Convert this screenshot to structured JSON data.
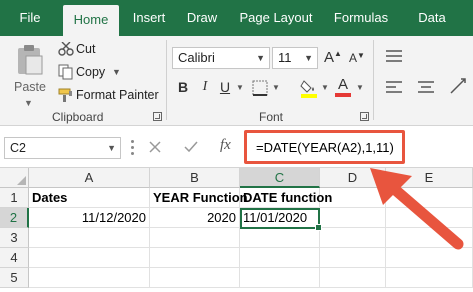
{
  "tabs": [
    {
      "label": "File",
      "active": false
    },
    {
      "label": "Home",
      "active": true
    },
    {
      "label": "Insert",
      "active": false
    },
    {
      "label": "Draw",
      "active": false
    },
    {
      "label": "Page Layout",
      "active": false
    },
    {
      "label": "Formulas",
      "active": false
    },
    {
      "label": "Data",
      "active": false
    }
  ],
  "clipboard": {
    "paste_label": "Paste",
    "cut_label": "Cut",
    "copy_label": "Copy",
    "format_painter_label": "Format Painter",
    "group_label": "Clipboard"
  },
  "font": {
    "name": "Calibri",
    "size": "11",
    "group_label": "Font",
    "grow_label": "A",
    "shrink_label": "A",
    "bold_label": "B",
    "italic_label": "I",
    "underline_label": "U",
    "font_color_label": "A"
  },
  "formula_bar": {
    "name_box": "C2",
    "fx_label": "fx",
    "formula": "=DATE(YEAR(A2),1,11)"
  },
  "sheet": {
    "columns": [
      "A",
      "B",
      "C",
      "D",
      "E"
    ],
    "rows": [
      "1",
      "2",
      "3",
      "4",
      "5"
    ],
    "cells": {
      "A1": "Dates",
      "B1": "YEAR Function",
      "C1": "DATE function",
      "A2": "11/12/2020",
      "B2": "2020",
      "C2": "11/01/2020"
    },
    "selected_cell": "C2"
  },
  "colors": {
    "brand": "#217346",
    "annotation": "#e8553e"
  }
}
